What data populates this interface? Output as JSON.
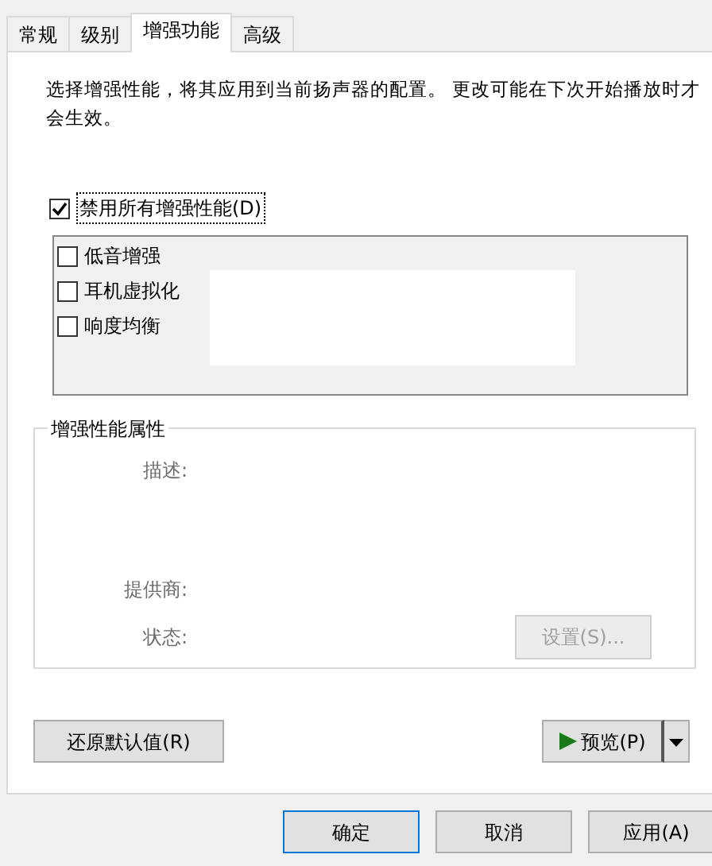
{
  "tabs": [
    {
      "label": "常规",
      "selected": false
    },
    {
      "label": "级别",
      "selected": false
    },
    {
      "label": "增强功能",
      "selected": true
    },
    {
      "label": "高级",
      "selected": false
    }
  ],
  "description": "选择增强性能，将其应用到当前扬声器的配置。 更改可能在下次开始播放时才会生效。",
  "disable_all": {
    "label": "禁用所有增强性能(D)",
    "checked": true
  },
  "enhancements": [
    {
      "label": "低音增强",
      "checked": false
    },
    {
      "label": "耳机虚拟化",
      "checked": false
    },
    {
      "label": "响度均衡",
      "checked": false
    }
  ],
  "properties": {
    "title": "增强性能属性",
    "fields": [
      "描述:",
      "提供商:",
      "状态:"
    ],
    "settings_button": {
      "label": "设置(S)...",
      "disabled": true
    }
  },
  "restore_button": "还原默认值(R)",
  "preview_button": {
    "label": "预览(P)"
  },
  "buttons": [
    {
      "label": "确定",
      "focused": true
    },
    {
      "label": "取消",
      "focused": false
    },
    {
      "label": "应用(A)",
      "focused": false
    }
  ]
}
